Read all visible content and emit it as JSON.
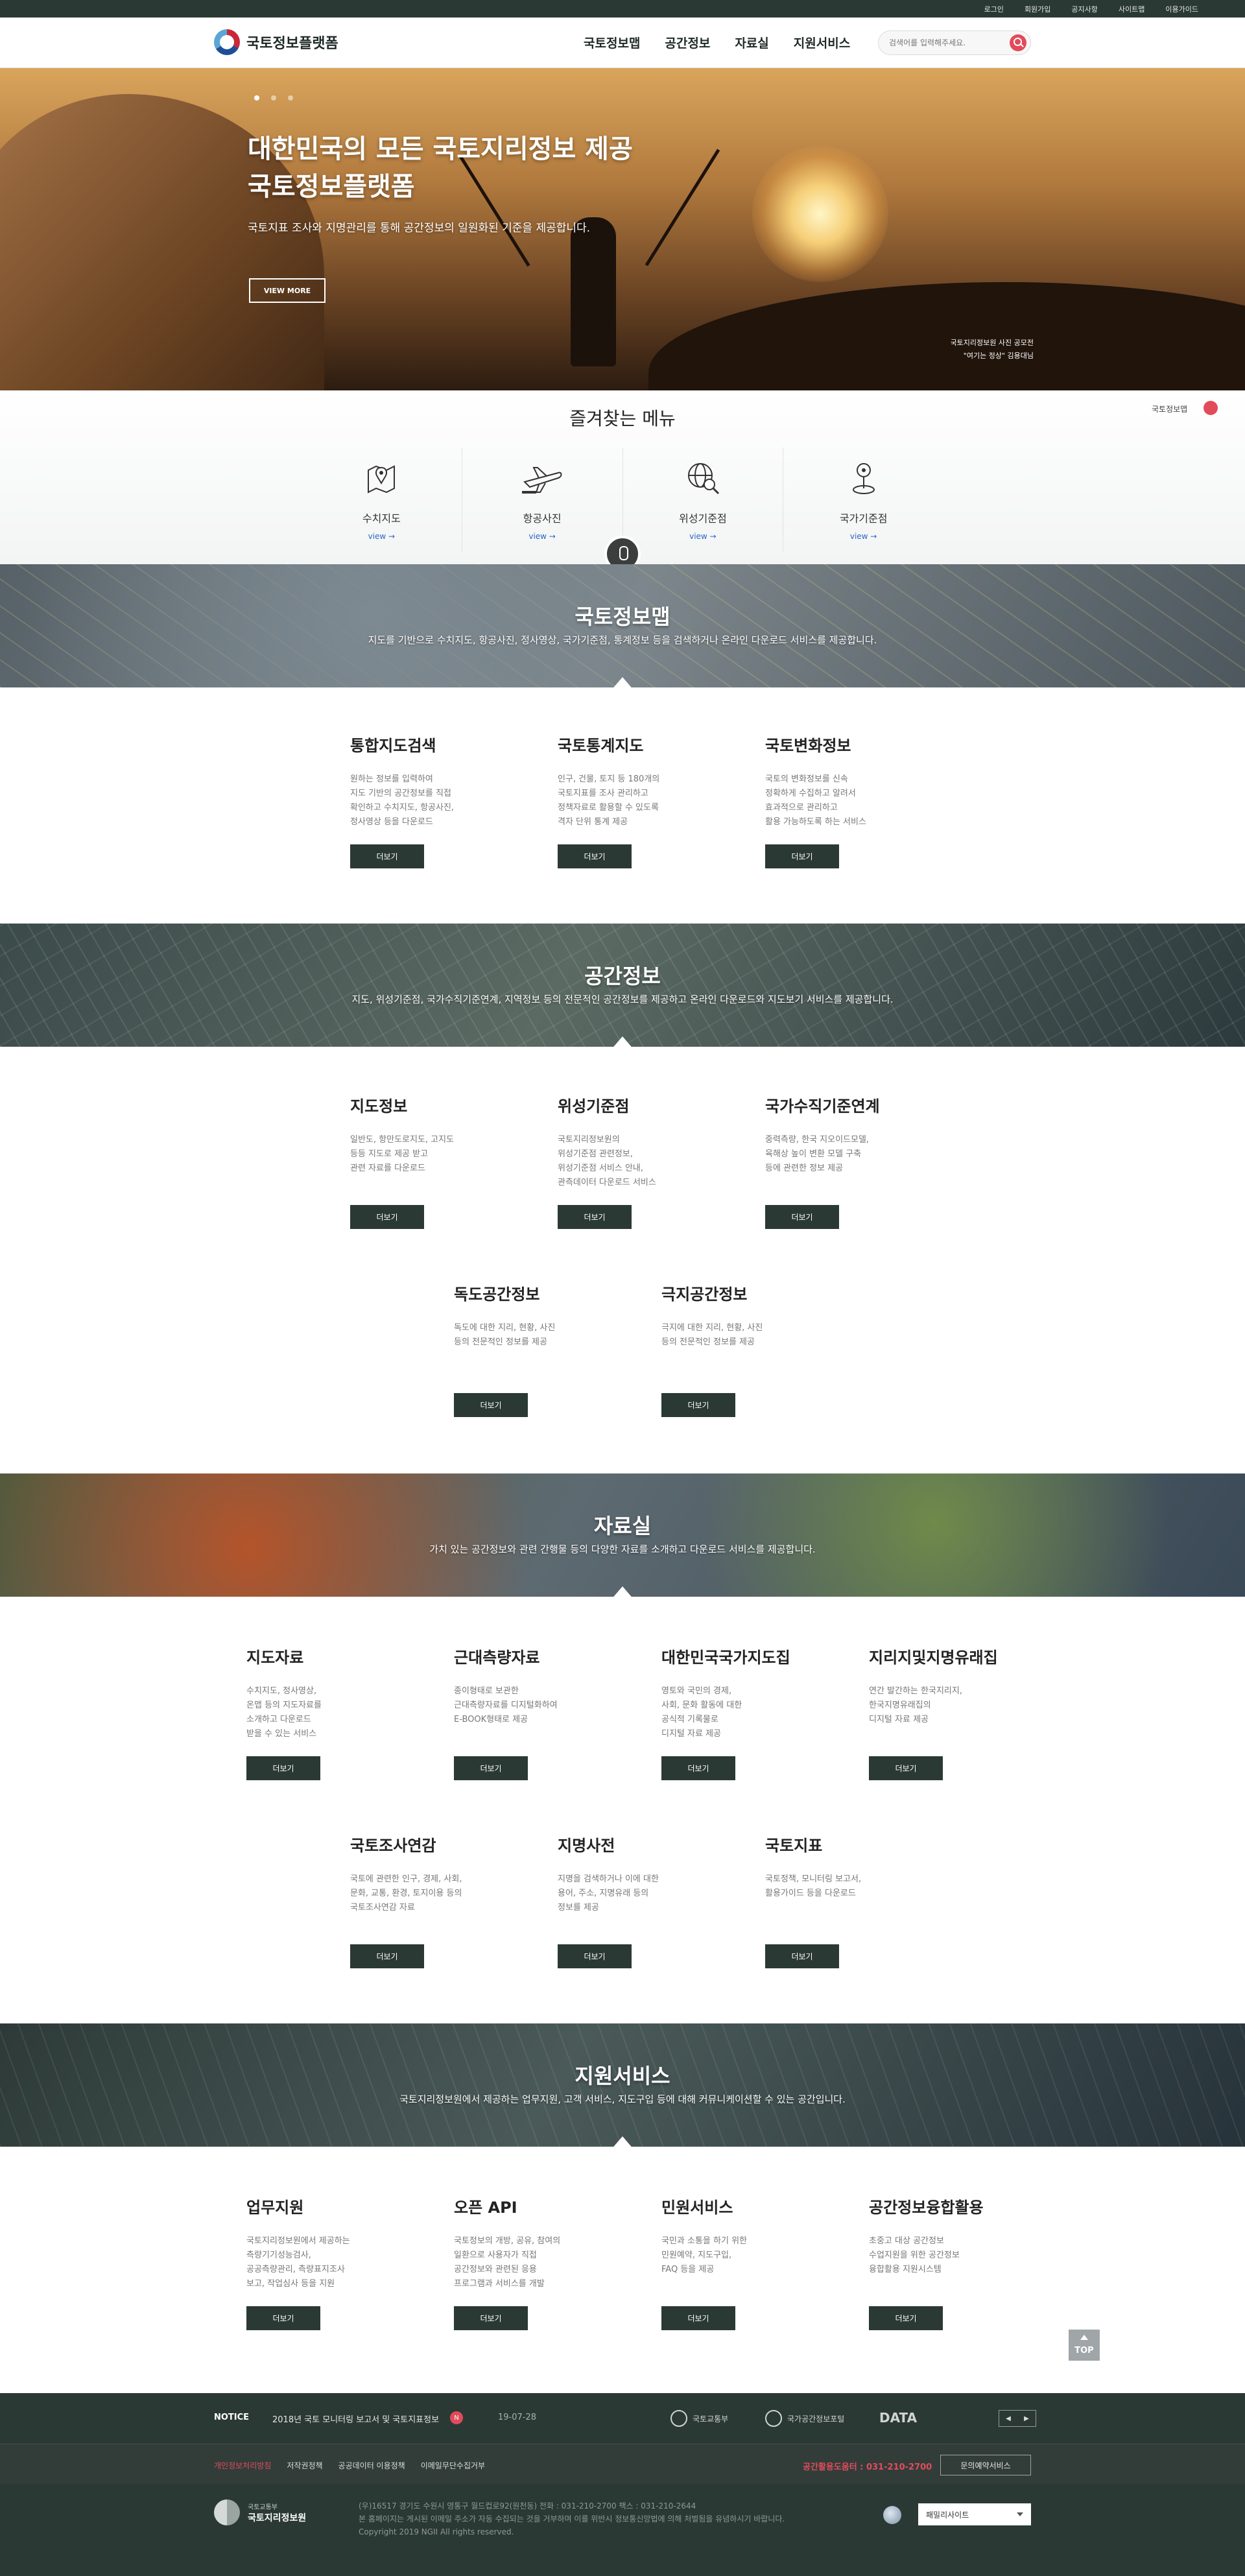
{
  "utility": [
    "로그인",
    "회원가입",
    "공지사항",
    "사이트맵",
    "이용가이드"
  ],
  "header": {
    "logo": "국토정보플랫폼",
    "nav": [
      "국토정보맵",
      "공간정보",
      "자료실",
      "지원서비스"
    ],
    "search_placeholder": "검색어를 입력해주세요."
  },
  "hero": {
    "title_line1": "대한민국의 모든 국토지리정보 제공",
    "title_line2": "국토정보플랫폼",
    "subtitle": "국토지표 조사와 지명관리를 통해 공간정보의 일원화된 기준을 제공합니다.",
    "button": "VIEW MORE",
    "credit_line1": "국토지리정보원 사진 공모전",
    "credit_line2": "\"여기는 정상\" 김용대님"
  },
  "favorites": {
    "title": "즐겨찾는 메뉴",
    "badge": "국토정보맵",
    "items": [
      {
        "icon": "map-pin-icon",
        "label": "수치지도",
        "view": "view →"
      },
      {
        "icon": "airplane-icon",
        "label": "항공사진",
        "view": "view →"
      },
      {
        "icon": "globe-search-icon",
        "label": "위성기준점",
        "view": "view →"
      },
      {
        "icon": "benchmark-pin-icon",
        "label": "국가기준점",
        "view": "view →"
      }
    ]
  },
  "sections": {
    "map": {
      "title": "국토정보맵",
      "subtitle": "지도를 기반으로 수치지도, 항공사진, 정사영상, 국가기준점, 통계정보 등을 검색하거나 온라인 다운로드 서비스를 제공합니다.",
      "cards": [
        {
          "title": "통합지도검색",
          "desc": "원하는 정보를 입력하여\n지도 기반의 공간정보를 직접\n확인하고 수치지도, 항공사진,\n정사영상 등을 다운로드",
          "button": "더보기"
        },
        {
          "title": "국토통계지도",
          "desc": "인구, 건물, 토지 등 180개의\n국토지표를 조사 관리하고\n정책자료로 활용할 수 있도록\n격자 단위 통계 제공",
          "button": "더보기"
        },
        {
          "title": "국토변화정보",
          "desc": "국토의 변화정보를 신속\n정확하게 수집하고 알려서\n효과적으로 관리하고\n활용 가능하도록 하는 서비스",
          "button": "더보기"
        }
      ]
    },
    "spatial": {
      "title": "공간정보",
      "subtitle": "지도, 위성기준점, 국가수직기준연계, 지역정보 등의 전문적인 공간정보를 제공하고 온라인 다운로드와 지도보기 서비스를 제공합니다.",
      "cards": [
        {
          "title": "지도정보",
          "desc": "일반도, 항만도로지도, 고지도\n등등 지도로 제공 받고\n관련 자료를 다운로드",
          "button": "더보기"
        },
        {
          "title": "위성기준점",
          "desc": "국토지리정보원의\n위성기준점 관련정보,\n위성기준점 서비스 안내,\n관측데이터 다운로드 서비스",
          "button": "더보기"
        },
        {
          "title": "국가수직기준연계",
          "desc": "중력측량, 한국 지오이드모델,\n육해상 높이 변환 모델 구축\n등에 관련한 정보 제공",
          "button": "더보기"
        },
        {
          "title": "독도공간정보",
          "desc": "독도에 대한 지리, 현황, 사진\n등의 전문적인 정보를 제공",
          "button": "더보기"
        },
        {
          "title": "극지공간정보",
          "desc": "극지에 대한 지리, 현황, 사진\n등의 전문적인 정보를 제공",
          "button": "더보기"
        }
      ]
    },
    "archive": {
      "title": "자료실",
      "subtitle": "가치 있는 공간정보와 관련 간행물 등의 다양한 자료를 소개하고 다운로드 서비스를 제공합니다.",
      "cards": [
        {
          "title": "지도자료",
          "desc": "수치지도, 정사영상,\n온맵 등의 지도자료를\n소개하고 다운로드\n받을 수 있는 서비스",
          "button": "더보기"
        },
        {
          "title": "근대측량자료",
          "desc": "종이형태로 보관한\n근대측량자료를 디지털화하여\nE-BOOK형태로 제공",
          "button": "더보기"
        },
        {
          "title": "대한민국국가지도집",
          "desc": "영토와 국민의 경제,\n사회, 문화 활동에 대한\n공식적 기록물로\n디지털 자료 제공",
          "button": "더보기"
        },
        {
          "title": "지리지및지명유래집",
          "desc": "연간 발간하는 한국지리지,\n한국지명유래집의\n디지털 자료 제공",
          "button": "더보기"
        },
        {
          "title": "국토조사연감",
          "desc": "국토에 관련한 인구, 경제, 사회,\n문화, 교통, 환경, 토지이용 등의\n국토조사연감 자료",
          "button": "더보기"
        },
        {
          "title": "지명사전",
          "desc": "지명을 검색하거나 이에 대한\n용어, 주소, 지명유래 등의\n정보를 제공",
          "button": "더보기"
        },
        {
          "title": "국토지표",
          "desc": "국토정책, 모니터링 보고서,\n활용가이드 등을 다운로드",
          "button": "더보기"
        }
      ]
    },
    "support": {
      "title": "지원서비스",
      "subtitle": "국토지리정보원에서 제공하는 업무지원, 고객 서비스, 지도구입 등에 대해 커뮤니케이션할 수 있는 공간입니다.",
      "cards": [
        {
          "title": "업무지원",
          "desc": "국토지리정보원에서 제공하는\n측량기기성능검사,\n공공측량관리, 측량표지조사\n보고, 작업심사 등을 지원",
          "button": "더보기"
        },
        {
          "title": "오픈 API",
          "desc": "국토정보의 개방, 공유, 참여의\n일환으로 사용자가 직접\n공간정보와 관련된 응용\n프로그램과 서비스를 개발",
          "button": "더보기"
        },
        {
          "title": "민원서비스",
          "desc": "국민과 소통을 하기 위한\n민원예약, 지도구입,\nFAQ 등을 제공",
          "button": "더보기"
        },
        {
          "title": "공간정보융합활용",
          "desc": "초중고 대상 공간정보\n수업지원을 위한 공간정보\n융합활용 지원시스템",
          "button": "더보기"
        }
      ]
    }
  },
  "top_button": "TOP",
  "notice": {
    "label": "NOTICE",
    "text": "2018년 국토 모니터링 보고서 및 국토지표정보",
    "new": "N",
    "date": "19-07-28",
    "partners": [
      "국토교통부",
      "국가공간정보포털",
      "DATA"
    ]
  },
  "footer": {
    "links": [
      "개인정보처리방침",
      "저작권정책",
      "공공데이터 이용정책",
      "이메일무단수집거부"
    ],
    "phone": "공간활용도움터 : 031-210-2700",
    "button": "문의예약서비스",
    "org_sub": "국토교통부",
    "org_main": "국토지리정보원",
    "address": "(우)16517 경기도 수원시 영통구 월드컵로92(원천동)   전화 : 031-210-2700   팩스 : 031-210-2644",
    "notice": "본 홈페이지는 게시된 이메일 주소가 자동 수집되는 것을 거부하며 이를 위반시 정보통신망법에 의해 처벌됨을 유념하시기 바랍니다.",
    "copyright": "Copyright 2019 NGII All rights reserved.",
    "family_site": "패밀리사이트"
  }
}
